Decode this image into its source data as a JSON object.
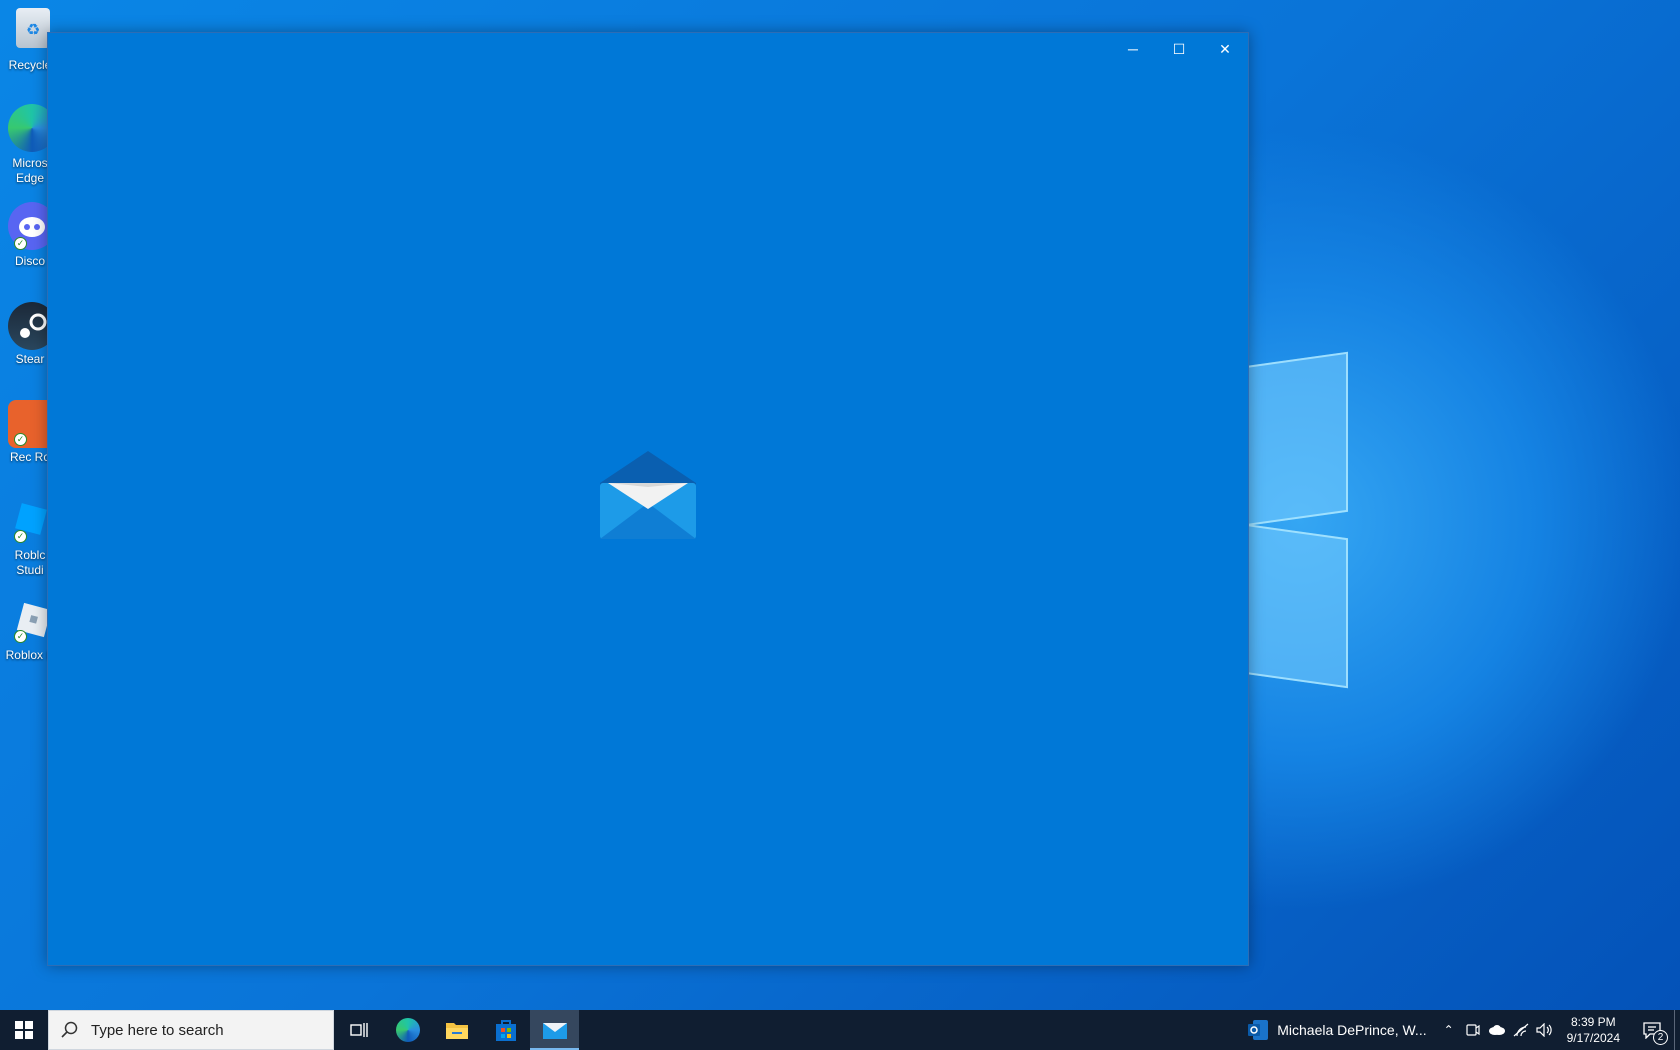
{
  "desktop": {
    "icons": [
      {
        "label": "Recycle",
        "icon": "recycle-bin-icon"
      },
      {
        "label": "Micros Edge",
        "icon": "edge-icon"
      },
      {
        "label": "Disco",
        "icon": "discord-icon"
      },
      {
        "label": "Stear",
        "icon": "steam-icon"
      },
      {
        "label": "Rec Ro",
        "icon": "rec-room-icon"
      },
      {
        "label": "Roblc Studi",
        "icon": "roblox-studio-icon"
      },
      {
        "label": "Roblox P",
        "icon": "roblox-player-icon"
      }
    ]
  },
  "window": {
    "minimize_glyph": "─",
    "maximize_glyph": "☐",
    "close_glyph": "✕",
    "background": "#0078d7"
  },
  "taskbar": {
    "search_placeholder": "Type here to search",
    "apps": [
      "task-view-icon",
      "edge-icon",
      "file-explorer-icon",
      "microsoft-store-icon",
      "mail-icon"
    ],
    "active_app": "mail",
    "contact_name": "Michaela DePrince, W...",
    "time": "8:39 PM",
    "date": "9/17/2024",
    "notification_count": "2"
  }
}
